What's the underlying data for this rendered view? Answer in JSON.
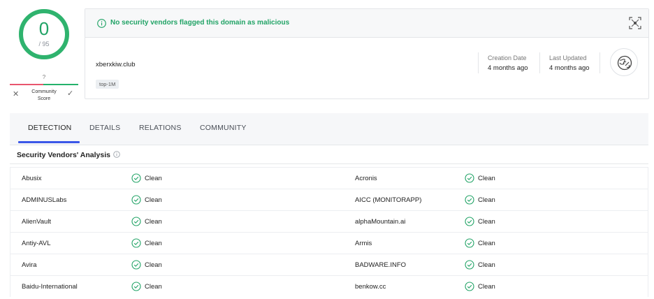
{
  "score": {
    "detections": "0",
    "total": "/ 95",
    "community_value": "?",
    "community_label_1": "Community",
    "community_label_2": "Score",
    "ring_fraction": 1.0
  },
  "summary": {
    "banner_text": "No security vendors flagged this domain as malicious",
    "domain": "xberxkiw.club",
    "tag": "top-1M",
    "creation_label": "Creation Date",
    "creation_value": "4 months ago",
    "updated_label": "Last Updated",
    "updated_value": "4 months ago"
  },
  "tabs": [
    "DETECTION",
    "DETAILS",
    "RELATIONS",
    "COMMUNITY"
  ],
  "section": {
    "title": "Security Vendors' Analysis"
  },
  "vendors": [
    {
      "left_name": "Abusix",
      "left_status": "Clean",
      "right_name": "Acronis",
      "right_status": "Clean"
    },
    {
      "left_name": "ADMINUSLabs",
      "left_status": "Clean",
      "right_name": "AICC (MONITORAPP)",
      "right_status": "Clean"
    },
    {
      "left_name": "AlienVault",
      "left_status": "Clean",
      "right_name": "alphaMountain.ai",
      "right_status": "Clean"
    },
    {
      "left_name": "Antiy-AVL",
      "left_status": "Clean",
      "right_name": "Armis",
      "right_status": "Clean"
    },
    {
      "left_name": "Avira",
      "left_status": "Clean",
      "right_name": "BADWARE.INFO",
      "right_status": "Clean"
    },
    {
      "left_name": "Baidu-International",
      "left_status": "Clean",
      "right_name": "benkow.cc",
      "right_status": "Clean"
    }
  ],
  "colors": {
    "green": "#21a366",
    "accent": "#3b57e8",
    "red": "#e8566e"
  }
}
